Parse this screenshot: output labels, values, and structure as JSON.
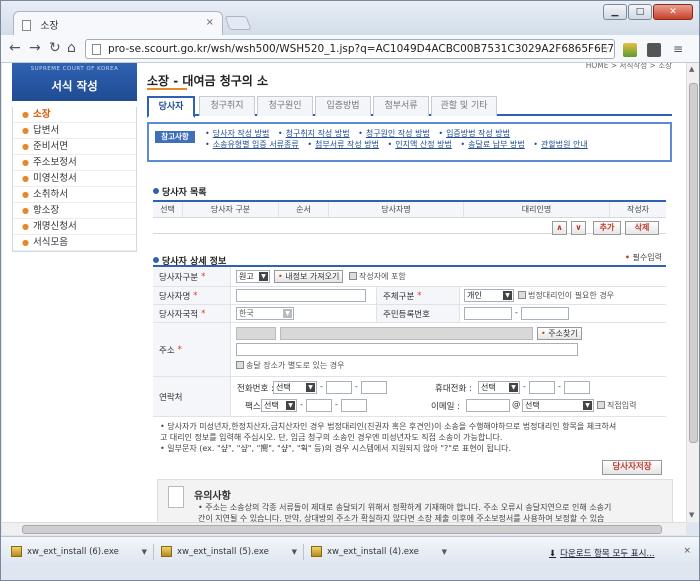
{
  "browser": {
    "tab_title": "소장",
    "tab_close": "×",
    "url": "pro-se.scourt.go.kr/wsh/wsh500/WSH520_1.jsp?q=AC1049D4ACBC00B7531C3029A2F6865F6E7B18..."
  },
  "sidebar": {
    "header_sub": "SUPREME COURT OF KOREA",
    "header_title": "서식 작성",
    "items": [
      "소장",
      "답변서",
      "준비서면",
      "주소보정서",
      "미영신청서",
      "소취하서",
      "항소장",
      "개명신청서",
      "서식모음"
    ]
  },
  "content": {
    "breadcrumb": "HOME > 서식작성 > 소장",
    "title": "소장 - 대여금 청구의 소",
    "tabs": [
      "당사자",
      "청구취지",
      "청구원인",
      "입증방법",
      "첨부서류",
      "관할 및 기타"
    ],
    "notice_badge": "참고사항",
    "links_row1": [
      "당사자 작성 방법",
      "청구취지 작성 방법",
      "청구원인 작성 방법",
      "입증방법 작성 방법"
    ],
    "links_row2": [
      "소송유형별 입증 서류종류",
      "첨부서류 작성 방법",
      "인지액 산정 방법",
      "송달료 납부 방법",
      "관할법원 안내"
    ],
    "party_list_title": "당사자 목록",
    "grid_headers": [
      "선택",
      "당사자 구분",
      "순서",
      "당사자명",
      "대리인명",
      "작성자"
    ],
    "btn_up": "∧",
    "btn_down": "∨",
    "btn_add": "추가",
    "btn_delete": "삭제",
    "detail_title": "당사자 상세 정보",
    "required_note": "필수입력"
  },
  "form": {
    "label_type": "당사자구분",
    "type_value": "원고",
    "btn_load_info": "내정보 가져오기",
    "chk_include_author": "작성자에 포함",
    "label_name": "당사자명",
    "label_entity": "주체구분",
    "entity_value": "개인",
    "chk_legal_rep": "법정대리인이 필요한 경우",
    "label_nationality": "당사자국적",
    "nationality_value": "한국",
    "label_rrn": "주민등록번호",
    "label_address": "주소",
    "btn_find_address": "주소찾기",
    "chk_separate_delivery": "송달 장소가 별도로 있는 경우",
    "label_contact": "연락처",
    "label_phone": "전화번호 :",
    "label_mobile": "휴대전화 :",
    "label_fax": "팩스 :",
    "label_email": "이메일 :",
    "select_placeholder": "선택",
    "email_at": "@",
    "chk_direct_input": "직접입력"
  },
  "notes": [
    "• 당사자가 미성년자,한정치산자,금치산자인 경우 법정대리인(친권자 혹은 후견인)이 소송을 수행해야하므로 법정대리인 항목을 체크하셔",
    "  고 대리인 정보를 입력해 주십시오. 단, 임금 청구의 소송인 경우엔 미성년자도 직접 소송이 가능합니다.",
    "• 일부문자 (ex. \"샾\", \"샾\", \"嚮\", \"샾\", \"훡\" 등)의 경우 시스템에서 지원되지 않아 \"?\"로 표현이 됩니다."
  ],
  "save_button": "당사자저장",
  "caution": {
    "title": "유의사항",
    "text1": "• 주소는 소송상의 각종 서류들이 제대로 송달되기 위해서 정확하게 기재해야 합니다. 주소 오류시 송달지연으로 인해 소송기",
    "text2": "  간이 지연될 수 있습니다. 만약, 상대방의 주소가 확실하지 않다면 소장 제출 이후에 주소보정서를 사용하여 보정할 수 있습"
  },
  "downloads": {
    "items": [
      "xw_ext_install (6).exe",
      "xw_ext_install (5).exe",
      "xw_ext_install (4).exe"
    ],
    "show_all": "다운로드 항목 모두 표시...",
    "close": "×"
  }
}
